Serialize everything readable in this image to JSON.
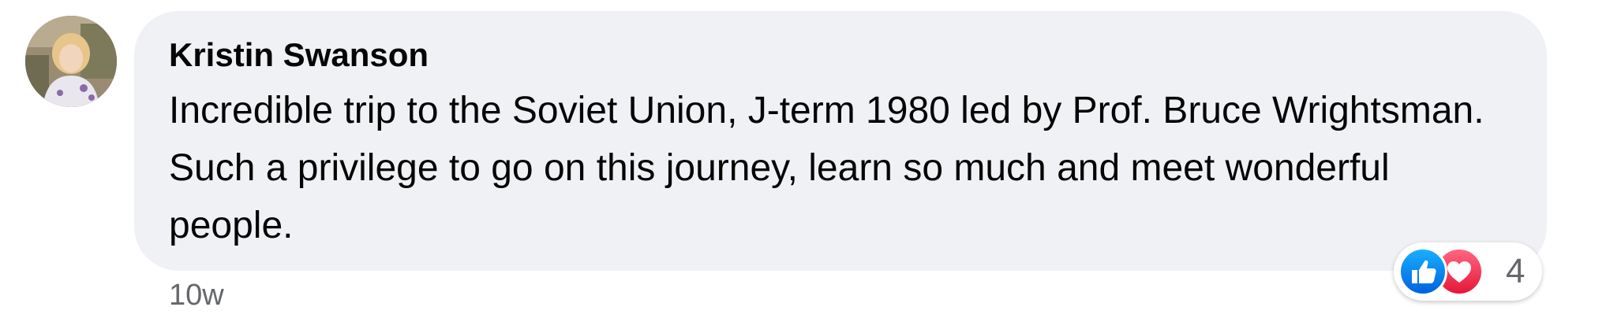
{
  "comment": {
    "author": "Kristin Swanson",
    "text": "Incredible trip to the Soviet Union, J-term 1980 led by Prof. Bruce Wrightsman. Such a privilege to go on this journey, learn so much and meet wonderful people.",
    "timestamp": "10w",
    "avatar_icon": "profile-photo",
    "reactions": {
      "types": [
        "like-icon",
        "love-icon"
      ],
      "count": "4",
      "colors": {
        "like": "#1877f2",
        "love": "#f33e58"
      }
    }
  },
  "colors": {
    "bubble": "#f0f1f4",
    "text": "#050505",
    "secondary": "#65676b"
  }
}
